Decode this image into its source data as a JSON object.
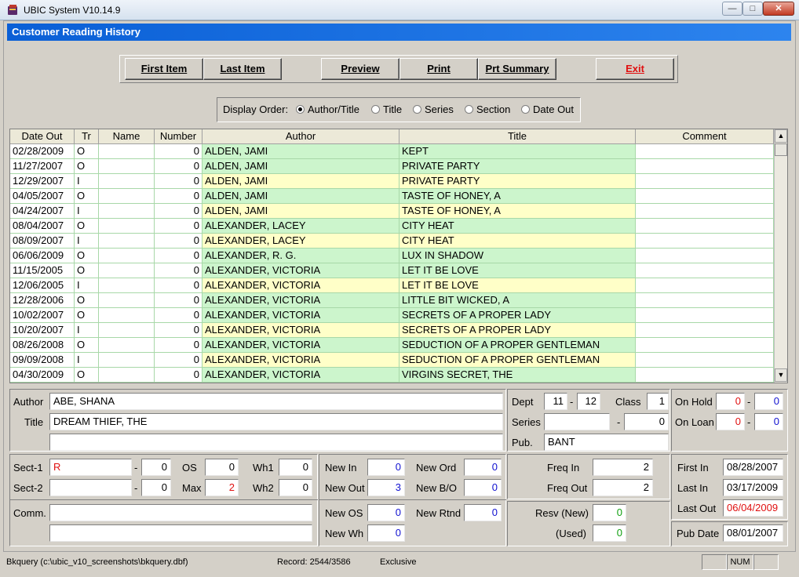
{
  "window": {
    "title": "UBIC System V10.14.9",
    "min": "—",
    "max": "□",
    "close": "✕"
  },
  "form": {
    "title": "Customer Reading History"
  },
  "buttons": {
    "first_item": "First Item",
    "last_item": "Last Item",
    "preview": "Preview",
    "print": "Print",
    "prt_summary": "Prt Summary",
    "exit": "Exit"
  },
  "display_order": {
    "label": "Display Order:",
    "options": [
      "Author/Title",
      "Title",
      "Series",
      "Section",
      "Date Out"
    ],
    "selected": "Author/Title"
  },
  "grid": {
    "columns": [
      "Date Out",
      "Tr",
      "Name",
      "Number",
      "Author",
      "Title",
      "Comment"
    ],
    "rows": [
      [
        "02/28/2009",
        "O",
        "",
        "0",
        "ALDEN, JAMI",
        "KEPT",
        ""
      ],
      [
        "11/27/2007",
        "O",
        "",
        "0",
        "ALDEN, JAMI",
        "PRIVATE PARTY",
        ""
      ],
      [
        "12/29/2007",
        "I",
        "",
        "0",
        "ALDEN, JAMI",
        "PRIVATE PARTY",
        ""
      ],
      [
        "04/05/2007",
        "O",
        "",
        "0",
        "ALDEN, JAMI",
        "TASTE OF HONEY, A",
        ""
      ],
      [
        "04/24/2007",
        "I",
        "",
        "0",
        "ALDEN, JAMI",
        "TASTE OF HONEY, A",
        ""
      ],
      [
        "08/04/2007",
        "O",
        "",
        "0",
        "ALEXANDER, LACEY",
        "CITY HEAT",
        ""
      ],
      [
        "08/09/2007",
        "I",
        "",
        "0",
        "ALEXANDER, LACEY",
        "CITY HEAT",
        ""
      ],
      [
        "06/06/2009",
        "O",
        "",
        "0",
        "ALEXANDER, R. G.",
        "LUX IN SHADOW",
        ""
      ],
      [
        "11/15/2005",
        "O",
        "",
        "0",
        "ALEXANDER, VICTORIA",
        "LET IT BE LOVE",
        ""
      ],
      [
        "12/06/2005",
        "I",
        "",
        "0",
        "ALEXANDER, VICTORIA",
        "LET IT BE LOVE",
        ""
      ],
      [
        "12/28/2006",
        "O",
        "",
        "0",
        "ALEXANDER, VICTORIA",
        "LITTLE BIT WICKED, A",
        ""
      ],
      [
        "10/02/2007",
        "O",
        "",
        "0",
        "ALEXANDER, VICTORIA",
        "SECRETS OF A PROPER LADY",
        ""
      ],
      [
        "10/20/2007",
        "I",
        "",
        "0",
        "ALEXANDER, VICTORIA",
        "SECRETS OF A PROPER LADY",
        ""
      ],
      [
        "08/26/2008",
        "O",
        "",
        "0",
        "ALEXANDER, VICTORIA",
        "SEDUCTION OF A PROPER GENTLEMAN",
        ""
      ],
      [
        "09/09/2008",
        "I",
        "",
        "0",
        "ALEXANDER, VICTORIA",
        "SEDUCTION OF A PROPER GENTLEMAN",
        ""
      ],
      [
        "04/30/2009",
        "O",
        "",
        "0",
        "ALEXANDER, VICTORIA",
        "VIRGINS SECRET, THE",
        ""
      ]
    ],
    "colors": {
      "out_row": "#ccf5cc",
      "in_row": "#ffffc8"
    }
  },
  "detail": {
    "author_label": "Author",
    "author": "ABE, SHANA",
    "title_label": "Title",
    "title": "DREAM THIEF, THE",
    "title2": "",
    "dept_label": "Dept",
    "dept1": "11",
    "dept_sep": "-",
    "dept2": "12",
    "class_label": "Class",
    "class": "1",
    "series_label": "Series",
    "series": "",
    "series_sep": "-",
    "series_num": "0",
    "pub_label": "Pub.",
    "pub": "BANT",
    "onhold_label": "On Hold",
    "onhold1": "0",
    "onhold_sep": "-",
    "onhold2": "0",
    "onloan_label": "On Loan",
    "onloan1": "0",
    "onloan_sep": "-",
    "onloan2": "0",
    "sect1_label": "Sect-1",
    "sect1": "R",
    "sect1_sep": "-",
    "sect1_num": "0",
    "sect2_label": "Sect-2",
    "sect2": "",
    "sect2_sep": "-",
    "sect2_num": "0",
    "os_label": "OS",
    "os": "0",
    "max_label": "Max",
    "max": "2",
    "wh1_label": "Wh1",
    "wh1": "0",
    "wh2_label": "Wh2",
    "wh2": "0",
    "comm_label": "Comm.",
    "comm1": "",
    "comm2": "",
    "newin_label": "New In",
    "newin": "0",
    "newout_label": "New Out",
    "newout": "3",
    "newos_label": "New OS",
    "newos": "0",
    "newwh_label": "New Wh",
    "newwh": "0",
    "neword_label": "New Ord",
    "neword": "0",
    "newbo_label": "New B/O",
    "newbo": "0",
    "newrtnd_label": "New Rtnd",
    "newrtnd": "0",
    "freqin_label": "Freq In",
    "freqin": "2",
    "freqout_label": "Freq Out",
    "freqout": "2",
    "resvnew_label": "Resv (New)",
    "resvnew": "0",
    "used_label": "(Used)",
    "used": "0",
    "firstin_label": "First In",
    "firstin": "08/28/2007",
    "lastin_label": "Last In",
    "lastin": "03/17/2009",
    "lastout_label": "Last Out",
    "lastout": "06/04/2009",
    "pubdate_label": "Pub Date",
    "pubdate": "08/01/2007"
  },
  "statusbar": {
    "file": "Bkquery (c:\\ubic_v10_screenshots\\bkquery.dbf)",
    "record": "Record: 2544/3586",
    "mode": "Exclusive",
    "num": "NUM"
  }
}
